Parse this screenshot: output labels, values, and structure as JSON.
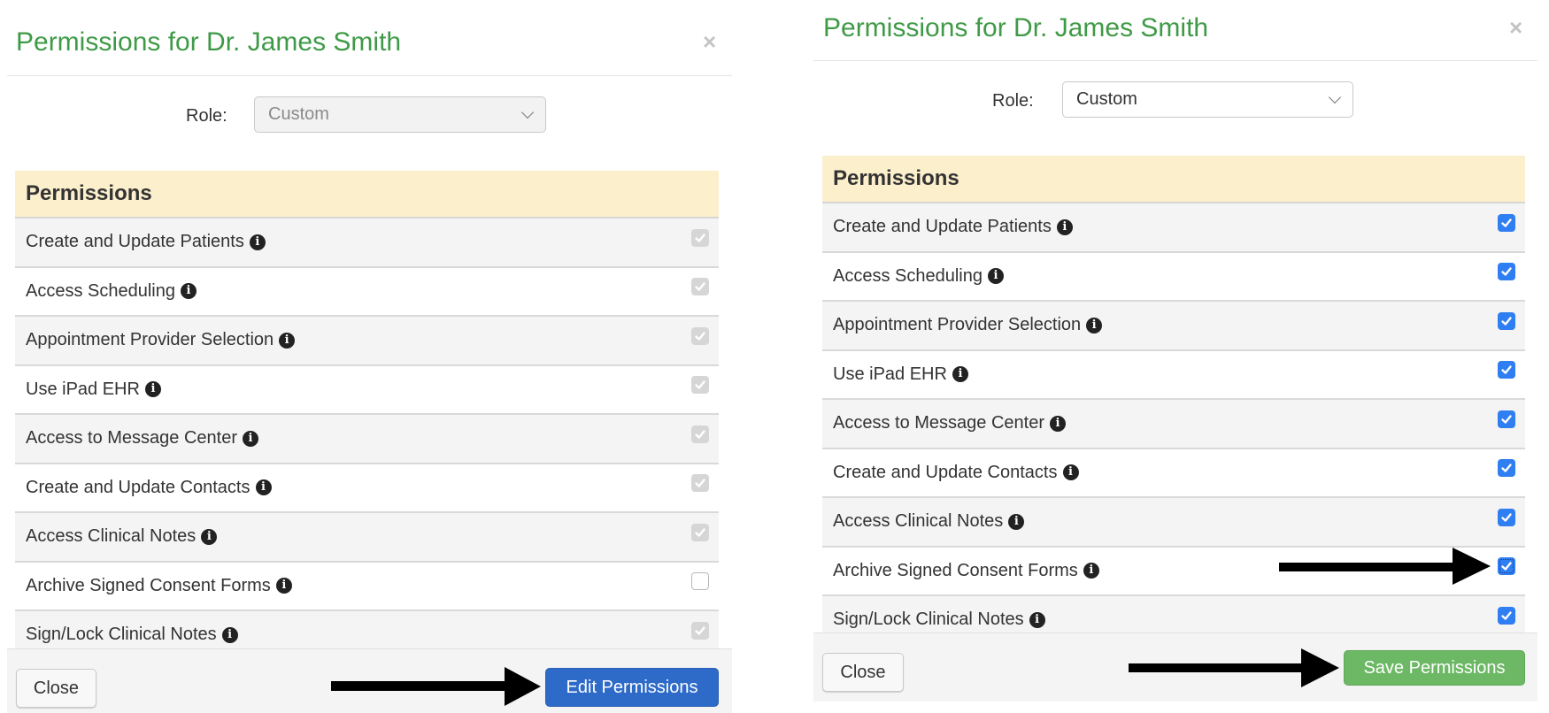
{
  "left_panel": {
    "title": "Permissions for Dr. James Smith",
    "close_icon": "×",
    "role_label": "Role:",
    "role_value": "Custom",
    "role_disabled": true,
    "table_header": "Permissions",
    "permissions": [
      {
        "label": "Create and Update Patients",
        "checked": true,
        "disabled": true
      },
      {
        "label": "Access Scheduling",
        "checked": true,
        "disabled": true
      },
      {
        "label": "Appointment Provider Selection",
        "checked": true,
        "disabled": true
      },
      {
        "label": "Use iPad EHR",
        "checked": true,
        "disabled": true
      },
      {
        "label": "Access to Message Center",
        "checked": true,
        "disabled": true
      },
      {
        "label": "Create and Update Contacts",
        "checked": true,
        "disabled": true
      },
      {
        "label": "Access Clinical Notes",
        "checked": true,
        "disabled": true
      },
      {
        "label": "Archive Signed Consent Forms",
        "checked": false,
        "disabled": true
      },
      {
        "label": "Sign/Lock Clinical Notes",
        "checked": true,
        "disabled": true
      }
    ],
    "close_button": "Close",
    "action_button": "Edit Permissions"
  },
  "right_panel": {
    "title": "Permissions for Dr. James Smith",
    "close_icon": "×",
    "role_label": "Role:",
    "role_value": "Custom",
    "role_disabled": false,
    "table_header": "Permissions",
    "permissions": [
      {
        "label": "Create and Update Patients",
        "checked": true,
        "disabled": false
      },
      {
        "label": "Access Scheduling",
        "checked": true,
        "disabled": false
      },
      {
        "label": "Appointment Provider Selection",
        "checked": true,
        "disabled": false
      },
      {
        "label": "Use iPad EHR",
        "checked": true,
        "disabled": false
      },
      {
        "label": "Access to Message Center",
        "checked": true,
        "disabled": false
      },
      {
        "label": "Create and Update Contacts",
        "checked": true,
        "disabled": false
      },
      {
        "label": "Access Clinical Notes",
        "checked": true,
        "disabled": false
      },
      {
        "label": "Archive Signed Consent Forms",
        "checked": true,
        "disabled": false,
        "focused": true
      },
      {
        "label": "Sign/Lock Clinical Notes",
        "checked": true,
        "disabled": false
      }
    ],
    "close_button": "Close",
    "action_button": "Save Permissions"
  },
  "icons": {
    "info": "i",
    "close": "close-icon",
    "chevron": "chevron-down-icon",
    "annotation_arrow": "arrow-right-icon"
  },
  "colors": {
    "title_green": "#3f9a47",
    "header_band": "#fcefcc",
    "primary_blue": "#2e6ac8",
    "success_green": "#6cb865",
    "checkbox_blue": "#2f7ef2",
    "checkbox_disabled": "#d6d6d6"
  }
}
